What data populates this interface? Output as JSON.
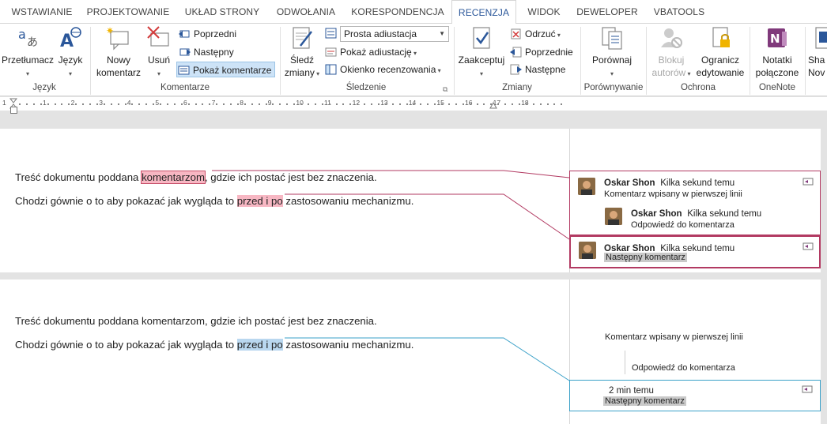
{
  "tabs": [
    "WSTAWIANIE",
    "PROJEKTOWANIE",
    "UKŁAD STRONY",
    "ODWOŁANIA",
    "KORESPONDENCJA",
    "RECENZJA",
    "WIDOK",
    "DEWELOPER",
    "VBATOOLS"
  ],
  "active_tab": "RECENZJA",
  "ribbon": {
    "jezyk": {
      "label": "Język",
      "translate": "Przetłumacz",
      "language": "Język"
    },
    "komentarze": {
      "label": "Komentarze",
      "new_line1": "Nowy",
      "new_line2": "komentarz",
      "delete": "Usuń",
      "prev": "Poprzedni",
      "next": "Następny",
      "show": "Pokaż komentarze"
    },
    "sledzenie": {
      "label": "Śledzenie",
      "track_line1": "Śledź",
      "track_line2": "zmiany",
      "markup_value": "Prosta adiustacja",
      "show_markup": "Pokaż adiustację",
      "review_pane": "Okienko recenzowania"
    },
    "zmiany": {
      "label": "Zmiany",
      "accept": "Zaakceptuj",
      "reject": "Odrzuć",
      "prev": "Poprzednie",
      "next": "Następne"
    },
    "porownywanie": {
      "label": "Porównywanie",
      "compare": "Porównaj"
    },
    "ochrona": {
      "label": "Ochrona",
      "block_line1": "Blokuj",
      "block_line2": "autorów",
      "restrict_line1": "Ogranicz",
      "restrict_line2": "edytowanie"
    },
    "onenote": {
      "label": "OneNote",
      "notes_line1": "Notatki",
      "notes_line2": "połączone"
    },
    "share": {
      "line1": "Sha",
      "line2": "Nov"
    }
  },
  "ruler_numbers": [
    "1",
    "1",
    "2",
    "3",
    "4",
    "5",
    "6",
    "7",
    "8",
    "9",
    "10",
    "11",
    "12",
    "13",
    "14",
    "15",
    "16",
    "17",
    "18"
  ],
  "doc1": {
    "line1_a": "Treść dokumentu poddana ",
    "line1_hl": "komentarzom",
    "line1_b": ", gdzie ich postać jest bez znaczenia.",
    "line2_a": "Chodzi gównie o to aby pokazać jak wygląda to ",
    "line2_hl": "przed i po",
    "line2_b": " zastosowaniu mechanizmu."
  },
  "comments1": [
    {
      "author": "Oskar Shon",
      "time": "Kilka sekund temu",
      "text": "Komentarz wpisany w pierwszej linii",
      "reply": {
        "author": "Oskar Shon",
        "time": "Kilka sekund temu",
        "text": "Odpowiedź do komentarza"
      }
    },
    {
      "author": "Oskar Shon",
      "time": "Kilka sekund temu",
      "text": "Następny komentarz"
    }
  ],
  "doc2": {
    "line1": "Treść dokumentu poddana komentarzom, gdzie ich postać jest bez znaczenia.",
    "line2_a": "Chodzi gównie o to aby pokazać jak wygląda to ",
    "line2_hl": "przed i po",
    "line2_b": " zastosowaniu mechanizmu."
  },
  "comments2": {
    "c1": "Komentarz wpisany w pierwszej linii",
    "reply": "Odpowiedź do komentarza",
    "c2_time": "2 min temu",
    "c2_text": "Następny komentarz"
  },
  "colors": {
    "accent": "#2b579a",
    "comment_border": "#b23a62",
    "comment_border_blue": "#3aa0c8",
    "highlight_red": "#f7b7c3",
    "highlight_blue": "#b9d7ef"
  }
}
